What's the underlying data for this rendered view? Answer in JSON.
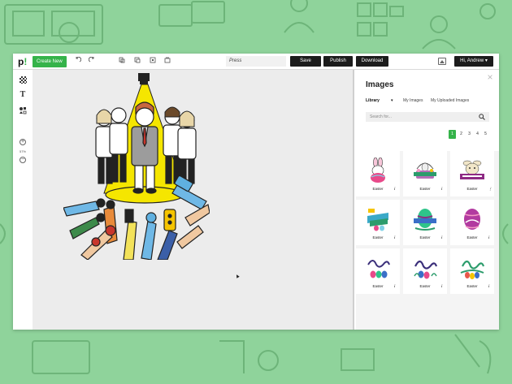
{
  "toolbar": {
    "logo": "p",
    "logo_accent": "!",
    "create_new": "Create New",
    "icons": [
      "undo-icon",
      "redo-icon",
      "copy-icon",
      "duplicate-icon",
      "group-icon",
      "resize-icon"
    ],
    "document_title": "Press",
    "save": "Save",
    "publish": "Publish",
    "download": "Download",
    "user_menu": "Hi, Andrew",
    "user_caret": "▾"
  },
  "leftbar": {
    "tools": [
      "background-icon",
      "text-icon",
      "shapes-icon"
    ],
    "text_tool_glyph": "T",
    "zoom_in": "+",
    "zoom_out": "−",
    "zoom_level": "57%"
  },
  "panel": {
    "title": "Images",
    "close": "×",
    "tabs": [
      "Library",
      "My Images",
      "My Uploaded Images"
    ],
    "active_tab": "Library",
    "tab_caret": "▾",
    "search_placeholder": "Search for...",
    "pages": [
      "1",
      "2",
      "3",
      "4",
      "5"
    ],
    "active_page": "1",
    "items": [
      {
        "label": "Easter",
        "info": "i",
        "icon": "easter-bunny-egg-icon"
      },
      {
        "label": "Easter",
        "info": "i",
        "icon": "easter-basket-icon"
      },
      {
        "label": "Easter",
        "info": "⋮",
        "icon": "happy-easter-bunny-banner-icon"
      },
      {
        "label": "Easter",
        "info": "i",
        "icon": "happy-easter-day-icon"
      },
      {
        "label": "Easter",
        "info": "i",
        "icon": "happy-easter-egg-banner-icon"
      },
      {
        "label": "Easter",
        "info": "i",
        "icon": "easter-egg-lettering-icon"
      },
      {
        "label": "Easter",
        "info": "i",
        "icon": "easter-lettering-eggs-icon"
      },
      {
        "label": "Easter",
        "info": "i",
        "icon": "easter-lettering-flowers-icon"
      },
      {
        "label": "Easter",
        "info": "i",
        "icon": "easter-lettering-wreath-icon"
      }
    ]
  },
  "colors": {
    "brand_green": "#35b34a",
    "background_green": "#8fd39b",
    "spotlight_yellow": "#f5e600",
    "dark_button": "#1c1c1c"
  }
}
